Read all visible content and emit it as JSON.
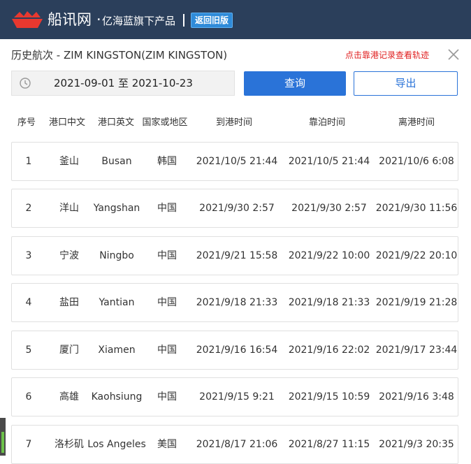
{
  "brand": {
    "name": "船讯网",
    "dot": "·",
    "tagline": "亿海蓝旗下产品",
    "back_old_label": "返回旧版",
    "logo_icon": "ship-logo-icon"
  },
  "dialog": {
    "title": "历史航次 - ZIM KINGSTON(ZIM KINGSTON)",
    "hint": "点击靠港记录查看轨迹",
    "close_icon": "close-icon"
  },
  "filter": {
    "date_range": "2021-09-01 至 2021-10-23",
    "clock_icon": "clock-icon",
    "query_label": "查询",
    "export_label": "导出"
  },
  "table": {
    "headers": [
      "序号",
      "港口中文",
      "港口英文",
      "国家或地区",
      "到港时间",
      "靠泊时间",
      "离港时间"
    ],
    "rows": [
      {
        "idx": "1",
        "port_cn": "釜山",
        "port_en": "Busan",
        "country": "韩国",
        "arrive": "2021/10/5 21:44",
        "berth": "2021/10/5 21:44",
        "depart": "2021/10/6 6:08"
      },
      {
        "idx": "2",
        "port_cn": "洋山",
        "port_en": "Yangshan",
        "country": "中国",
        "arrive": "2021/9/30 2:57",
        "berth": "2021/9/30 2:57",
        "depart": "2021/9/30 11:56"
      },
      {
        "idx": "3",
        "port_cn": "宁波",
        "port_en": "Ningbo",
        "country": "中国",
        "arrive": "2021/9/21 15:58",
        "berth": "2021/9/22 10:00",
        "depart": "2021/9/22 20:10"
      },
      {
        "idx": "4",
        "port_cn": "盐田",
        "port_en": "Yantian",
        "country": "中国",
        "arrive": "2021/9/18 21:33",
        "berth": "2021/9/18 21:33",
        "depart": "2021/9/19 21:28"
      },
      {
        "idx": "5",
        "port_cn": "厦门",
        "port_en": "Xiamen",
        "country": "中国",
        "arrive": "2021/9/16 16:54",
        "berth": "2021/9/16 22:02",
        "depart": "2021/9/17 23:44"
      },
      {
        "idx": "6",
        "port_cn": "高雄",
        "port_en": "Kaohsiung",
        "country": "中国",
        "arrive": "2021/9/15 9:21",
        "berth": "2021/9/15 10:59",
        "depart": "2021/9/16 3:48"
      },
      {
        "idx": "7",
        "port_cn": "洛杉矶",
        "port_en": "Los Angeles",
        "country": "美国",
        "arrive": "2021/8/17 21:06",
        "berth": "2021/8/27 11:15",
        "depart": "2021/9/3 20:35"
      }
    ]
  },
  "colors": {
    "topbar": "#2b3f5b",
    "accent": "#2a73d8",
    "hint_red": "#e02020",
    "logo_red": "#e8382f"
  }
}
